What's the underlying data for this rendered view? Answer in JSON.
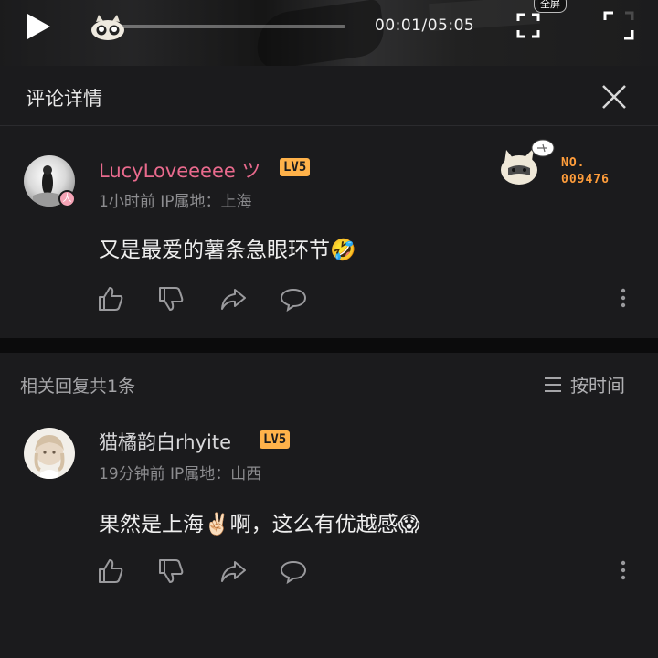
{
  "video": {
    "timecode": "00:01/05:05",
    "fullscreen_label": "全屏",
    "progress": 0.003
  },
  "header": {
    "title": "评论详情"
  },
  "main_comment": {
    "username": "LucyLoveeeee ツ",
    "level": "LV5",
    "avatar_badge": "大",
    "meta": "1小时前  IP属地：上海",
    "text": "又是最爱的薯条急眼环节🤣",
    "badge_label": "NO.",
    "badge_number": "009476",
    "username_color": "#e96a8d"
  },
  "related": {
    "count_label": "相关回复共1条",
    "sort_label": "按时间"
  },
  "reply": {
    "username": "猫橘韵白rhyite",
    "level": "LV5",
    "meta": "19分钟前  IP属地：山西",
    "text": "果然是上海✌🏻啊，这么有优越感😱"
  },
  "colors": {
    "accent": "#ffb24a",
    "background": "#161618"
  }
}
